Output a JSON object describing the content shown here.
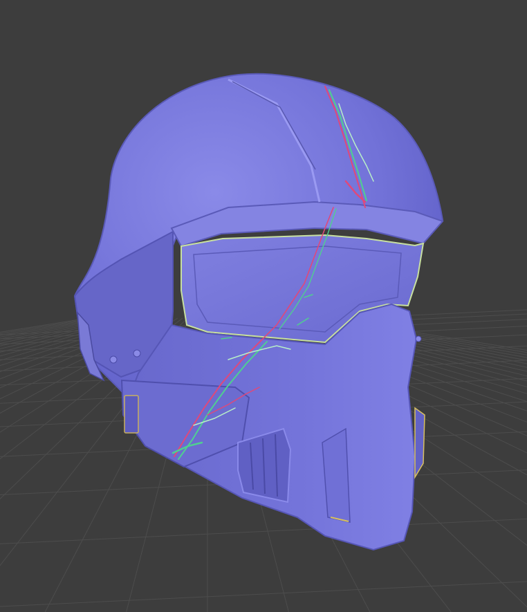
{
  "viewport": {
    "background_color": "#3d3d3d",
    "grid_line_color": "#4d4d4d",
    "grid_enabled": true
  },
  "model": {
    "object": "helmet",
    "shading": "normal-map",
    "base_color": "#7272d8",
    "shadow_color": "#4a4aa8",
    "highlight_color": "#9a9af2",
    "damage_colors": [
      "#e0487a",
      "#4fd090",
      "#b8f0c8",
      "#d8c060"
    ]
  }
}
